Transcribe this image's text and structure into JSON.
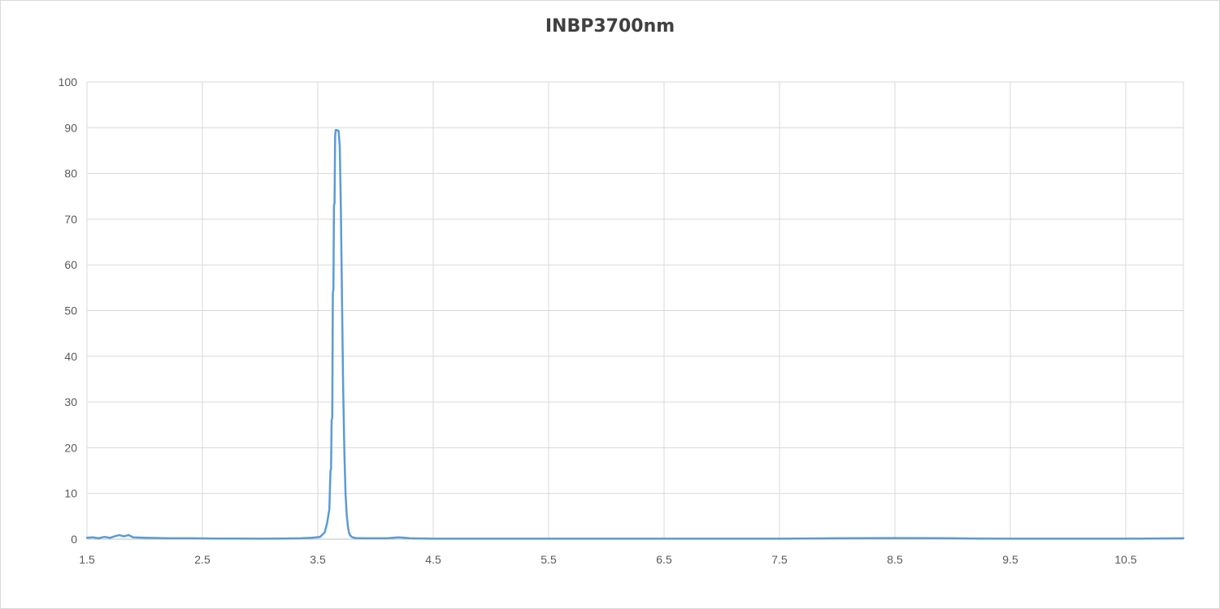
{
  "chart_data": {
    "type": "line",
    "title": "INBP3700nm",
    "xlabel": "",
    "ylabel": "",
    "xlim": [
      1.5,
      11.0
    ],
    "ylim": [
      0,
      100
    ],
    "x_ticks": [
      "1.5",
      "2.5",
      "3.5",
      "4.5",
      "5.5",
      "6.5",
      "7.5",
      "8.5",
      "9.5",
      "10.5"
    ],
    "x_tick_values": [
      1.5,
      2.5,
      3.5,
      4.5,
      5.5,
      6.5,
      7.5,
      8.5,
      9.5,
      10.5
    ],
    "y_ticks": [
      "0",
      "10",
      "20",
      "30",
      "40",
      "50",
      "60",
      "70",
      "80",
      "90",
      "100"
    ],
    "y_tick_values": [
      0,
      10,
      20,
      30,
      40,
      50,
      60,
      70,
      80,
      90,
      100
    ],
    "grid": true,
    "legend": "none",
    "series": [
      {
        "color": "#5b9bd5",
        "x": [
          1.5,
          1.55,
          1.6,
          1.65,
          1.7,
          1.75,
          1.78,
          1.82,
          1.86,
          1.9,
          2.0,
          2.2,
          2.4,
          2.6,
          2.8,
          3.0,
          3.2,
          3.35,
          3.45,
          3.52,
          3.56,
          3.58,
          3.6,
          3.61,
          3.615,
          3.62,
          3.625,
          3.63,
          3.635,
          3.64,
          3.645,
          3.65,
          3.655,
          3.66,
          3.68,
          3.69,
          3.7,
          3.71,
          3.72,
          3.73,
          3.74,
          3.75,
          3.76,
          3.77,
          3.78,
          3.8,
          3.83,
          3.9,
          4.0,
          4.1,
          4.2,
          4.25,
          4.3,
          4.5,
          5.0,
          5.5,
          6.0,
          6.5,
          7.0,
          7.5,
          8.0,
          8.5,
          9.0,
          9.2,
          9.5,
          10.0,
          10.5,
          11.0
        ],
        "y": [
          0.3,
          0.4,
          0.2,
          0.5,
          0.3,
          0.7,
          0.9,
          0.6,
          0.9,
          0.4,
          0.3,
          0.2,
          0.2,
          0.15,
          0.15,
          0.1,
          0.15,
          0.2,
          0.3,
          0.5,
          1.5,
          3.5,
          6.5,
          15,
          15.3,
          26,
          26.5,
          54,
          54.5,
          73,
          73.5,
          88,
          89.5,
          89.5,
          89.3,
          86,
          72,
          52,
          33,
          19,
          10,
          5.5,
          3,
          1.5,
          0.8,
          0.4,
          0.25,
          0.2,
          0.2,
          0.2,
          0.4,
          0.3,
          0.2,
          0.1,
          0.1,
          0.1,
          0.1,
          0.1,
          0.1,
          0.1,
          0.2,
          0.25,
          0.2,
          0.15,
          0.1,
          0.1,
          0.1,
          0.2
        ]
      }
    ]
  }
}
